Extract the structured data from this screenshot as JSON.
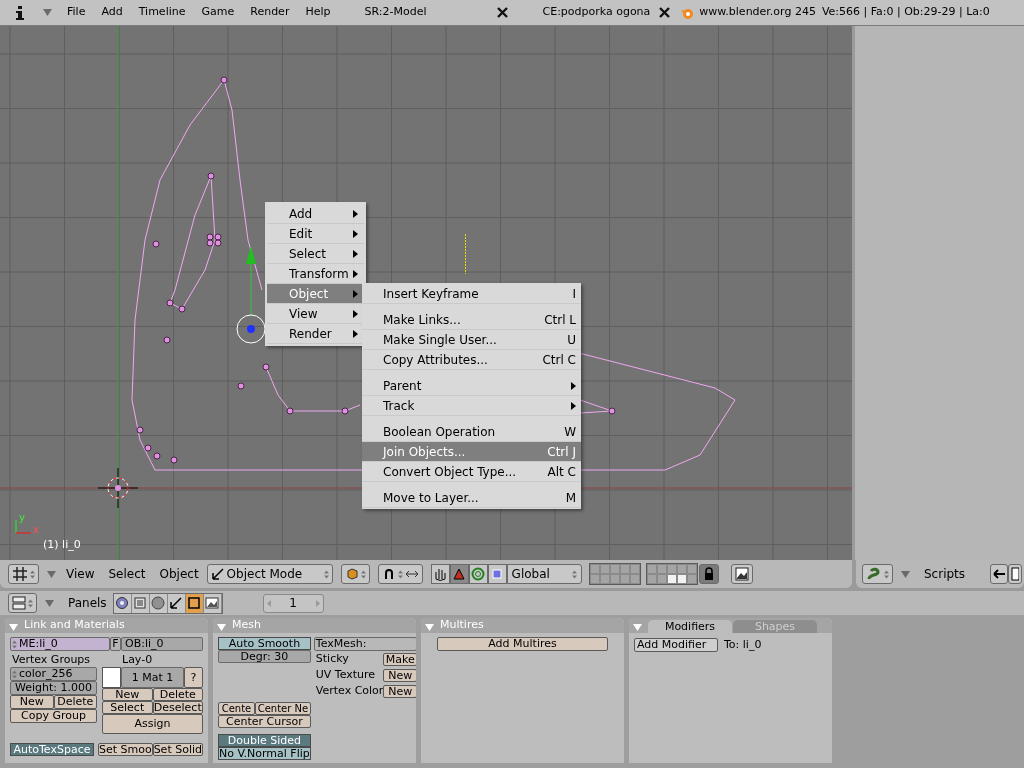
{
  "top_bar": {
    "menus": [
      "File",
      "Add",
      "Timeline",
      "Game",
      "Render",
      "Help"
    ],
    "screen": "SR:2-Model",
    "scene": "CE:podporka ogona",
    "version": "www.blender.org 245",
    "stats": "Ve:566 | Fa:0 | Ob:29-29 | La:0"
  },
  "viewport": {
    "axis_x": "x",
    "axis_y": "y",
    "object_label": "(1) li_0",
    "context_menu": [
      {
        "label": "Add",
        "selected": false
      },
      {
        "label": "Edit",
        "selected": false
      },
      {
        "label": "Select",
        "selected": false
      },
      {
        "label": "Transform",
        "selected": false
      },
      {
        "label": "Object",
        "selected": true
      },
      {
        "label": "View",
        "selected": false
      },
      {
        "label": "Render",
        "selected": false
      }
    ],
    "submenu": [
      [
        {
          "label": "Insert Keyframe",
          "shortcut": "I",
          "kind": "command",
          "selected": false
        }
      ],
      [
        {
          "label": "Make Links...",
          "shortcut": "Ctrl L",
          "kind": "command",
          "selected": false
        },
        {
          "label": "Make Single User...",
          "shortcut": "U",
          "kind": "command",
          "selected": false
        },
        {
          "label": "Copy Attributes...",
          "shortcut": "Ctrl C",
          "kind": "command",
          "selected": false
        }
      ],
      [
        {
          "label": "Parent",
          "kind": "submenu",
          "selected": false
        },
        {
          "label": "Track",
          "kind": "submenu",
          "selected": false
        }
      ],
      [
        {
          "label": "Boolean Operation",
          "shortcut": "W",
          "kind": "command",
          "selected": false
        },
        {
          "label": "Join Objects...",
          "shortcut": "Ctrl J",
          "kind": "command",
          "selected": true
        },
        {
          "label": "Convert Object Type...",
          "shortcut": "Alt C",
          "kind": "command",
          "selected": false
        }
      ],
      [
        {
          "label": "Move to Layer...",
          "shortcut": "M",
          "kind": "command",
          "selected": false
        }
      ]
    ]
  },
  "viewport_header": {
    "menus": [
      "View",
      "Select",
      "Object"
    ],
    "mode": "Object Mode",
    "manipulators": [
      {
        "selected": false
      },
      {
        "selected": true
      },
      {
        "selected": false
      },
      {
        "selected": false
      }
    ],
    "orientation": "Global",
    "layers": [
      {
        "on": false
      },
      {
        "on": false
      },
      {
        "on": false
      },
      {
        "on": false
      },
      {
        "on": false
      },
      {
        "on": false
      },
      {
        "on": false
      },
      {
        "on": false
      },
      {
        "on": false
      },
      {
        "on": false
      },
      {
        "on": false
      },
      {
        "on": false
      },
      {
        "on": false
      },
      {
        "on": false
      },
      {
        "on": false
      },
      {
        "on": false
      },
      {
        "on": false
      },
      {
        "on": true
      },
      {
        "on": true
      },
      {
        "on": false
      }
    ]
  },
  "scripts_header": {
    "label": "Scripts"
  },
  "buttons_header": {
    "label": "Panels",
    "tabs": [
      {
        "selected": false
      },
      {
        "selected": false
      },
      {
        "selected": false
      },
      {
        "selected": false
      },
      {
        "selected": true
      },
      {
        "selected": false
      }
    ],
    "page": "1"
  },
  "panels": {
    "link_materials": {
      "title": "Link and Materials",
      "mesh_name": "ME:li_0",
      "fake_user": "F",
      "object_name": "OB:li_0",
      "vertex_groups_label": "Vertex Groups",
      "vertex_group": "color_256",
      "weight": "Weight: 1.000",
      "group_buttons": [
        "New",
        "Delete",
        "Copy Group"
      ],
      "layer_label": "Lay-0",
      "material": "1 Mat 1",
      "material_help": "?",
      "material_buttons": [
        "New",
        "Delete",
        "Select",
        "Deselect",
        "Assign"
      ],
      "auto_tex_space": {
        "label": "AutoTexSpace",
        "on": true
      },
      "smooth_buttons": [
        "Set Smoo",
        "Set Solid"
      ]
    },
    "mesh": {
      "title": "Mesh",
      "auto_smooth": {
        "label": "Auto Smooth",
        "on": false
      },
      "degree": "Degr: 30",
      "center_buttons": [
        "Cente",
        "Center Ne",
        "Center Cursor"
      ],
      "double_sided": {
        "label": "Double Sided",
        "on": true
      },
      "no_vnormal_flip": {
        "label": "No V.Normal Flip",
        "on": false
      },
      "texmesh": "TexMesh:",
      "data_rows": [
        {
          "label": "Sticky",
          "button": "Make"
        },
        {
          "label": "UV Texture",
          "button": "New"
        },
        {
          "label": "Vertex Color",
          "button": "New"
        }
      ]
    },
    "multires": {
      "title": "Multires",
      "button": "Add Multires"
    },
    "modifiers": {
      "tabs": [
        {
          "label": "Modifiers",
          "selected": true
        },
        {
          "label": "Shapes",
          "selected": false
        }
      ],
      "button": "Add Modifier",
      "target": "To: li_0"
    }
  }
}
